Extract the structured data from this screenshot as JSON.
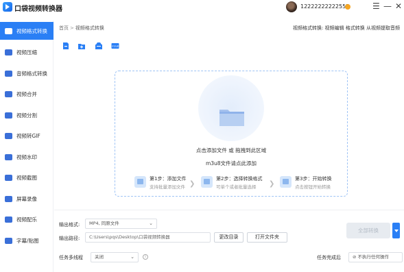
{
  "app": {
    "title": "口袋视频转换器",
    "phone": "12222222222555"
  },
  "window": {
    "menu_glyph": "☰",
    "minimize_glyph": "—",
    "close_glyph": "✕"
  },
  "sidebar": {
    "items": [
      {
        "label": "视频格式转换",
        "icon": "video-convert-icon",
        "active": true
      },
      {
        "label": "视频压缩",
        "icon": "compress-icon"
      },
      {
        "label": "音频格式转换",
        "icon": "audio-icon"
      },
      {
        "label": "视频合并",
        "icon": "merge-icon"
      },
      {
        "label": "视频分割",
        "icon": "split-icon"
      },
      {
        "label": "视频转GIF",
        "icon": "gif-icon"
      },
      {
        "label": "视频水印",
        "icon": "watermark-icon"
      },
      {
        "label": "视频截图",
        "icon": "screenshot-icon"
      },
      {
        "label": "屏幕录像",
        "icon": "screen-record-icon"
      },
      {
        "label": "视频配乐",
        "icon": "music-icon"
      },
      {
        "label": "字幕/贴图",
        "icon": "subtitle-icon"
      }
    ]
  },
  "breadcrumb": {
    "home": "首页",
    "sep": ">",
    "current": "视频格式转换"
  },
  "top_links": "视频格式转换: 视频编辑 格式转换 从视频提取音频",
  "toolbar": {
    "m3u8_label": "m3u8"
  },
  "dropzone": {
    "main_text": "点击添加文件 或 拖拽到此区域",
    "sub_text": "m3u8文件请点此添加",
    "steps": [
      {
        "title": "第1步：添加文件",
        "desc": "支持批量添加文件"
      },
      {
        "title": "第2步：选择转换格式",
        "desc": "可单个或者批量选择"
      },
      {
        "title": "第3步：开始转换",
        "desc": "点击按钮开始转换"
      }
    ],
    "arrow_glyph": "❯"
  },
  "output": {
    "format_label": "输出格式:",
    "format_value": "MP4, 同原文件",
    "path_label": "输出路径:",
    "path_value": "C:\\Users\\pqs\\Desktop\\口袋视频转换器",
    "change_dir_button": "更改目录",
    "open_folder_button": "打开文件夹",
    "convert_all_button": "全部转换"
  },
  "tasks": {
    "multithread_label": "任务多线程",
    "multithread_value": "关闭",
    "info_glyph": "i",
    "after_label": "任务完成后",
    "after_value": "不执行任何操作",
    "after_icon": "⊘"
  },
  "colors": {
    "accent": "#2a7ff5",
    "dropzone_border": "#9ec3f5"
  }
}
